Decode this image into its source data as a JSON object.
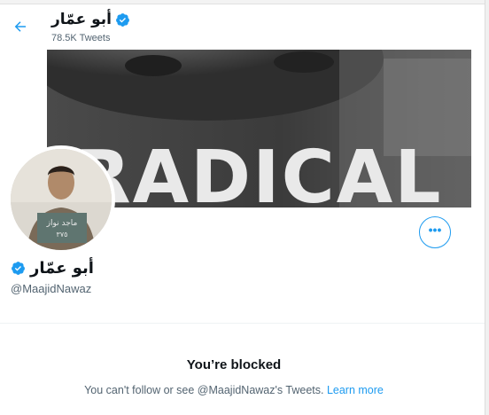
{
  "header": {
    "name": "أبو عمّار",
    "tweet_count": "78.5K Tweets"
  },
  "banner": {
    "text": "RADICAL"
  },
  "profile": {
    "name": "أبو عمّار",
    "handle": "@MaajidNawaz"
  },
  "blocked": {
    "title": "You’re blocked",
    "description": "You can't follow or see @MaajidNawaz's Tweets.",
    "link": "Learn more"
  },
  "colors": {
    "accent": "#1d9bf0",
    "text_secondary": "#536471"
  },
  "icons": {
    "back": "arrow-left-icon",
    "verified": "verified-badge-icon",
    "more": "more-options-icon"
  }
}
